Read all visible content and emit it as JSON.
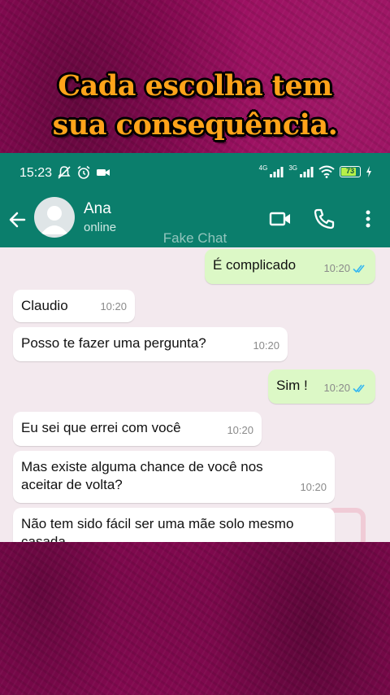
{
  "overlay": {
    "headline_line1": "Cada escolha tem",
    "headline_line2": "sua consequência."
  },
  "status_bar": {
    "time": "15:23",
    "network_1": "4G",
    "network_2": "3G",
    "battery": "73"
  },
  "app_bar": {
    "contact_name": "Ana",
    "contact_status": "online",
    "watermark": "Fake Chat",
    "icons": [
      "back-arrow-icon",
      "video-call-icon",
      "phone-icon",
      "more-options-icon"
    ]
  },
  "colors": {
    "header": "#0b7e6c",
    "outgoing_bubble": "#dcf8c6",
    "incoming_bubble": "#ffffff",
    "chat_background": "#f3e9ee",
    "read_ticks": "#34b7f1",
    "headline": "#ffa31a",
    "page_background": "#9a0b5e"
  },
  "messages": [
    {
      "direction": "out",
      "text": "É complicado",
      "time": "10:20",
      "read": true
    },
    {
      "direction": "in",
      "text": "Claudio",
      "time": "10:20"
    },
    {
      "direction": "in",
      "text": "Posso te fazer uma pergunta?",
      "time": "10:20"
    },
    {
      "direction": "out",
      "text": "Sim !",
      "time": "10:20",
      "read": true
    },
    {
      "direction": "in",
      "text": "Eu sei que errei com você",
      "time": "10:20"
    },
    {
      "direction": "in",
      "text": "Mas existe alguma chance de você nos aceitar de volta?",
      "time": "10:20"
    },
    {
      "direction": "in",
      "text": "Não tem sido fácil ser uma mãe solo mesmo casada",
      "time": ""
    }
  ]
}
